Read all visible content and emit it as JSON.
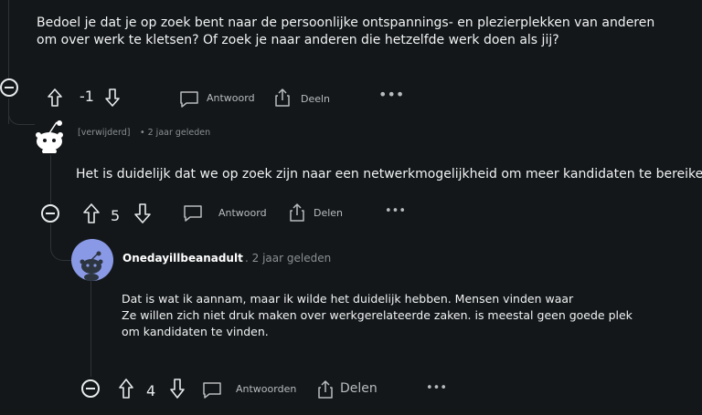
{
  "comment1": {
    "text": "Bedoel je dat je op zoek bent naar de persoonlijke ontspannings- en plezierplekken van anderen om over werk te kletsen? Of zoek je naar anderen die hetzelfde werk doen als jij?",
    "score": "-1",
    "reply_label": "Antwoord",
    "share_label": "Deeln"
  },
  "comment2": {
    "author": "[verwijderd]",
    "time": "• 2 jaar geleden",
    "text": "Het is duidelijk dat we op zoek zijn naar een netwerkmogelijkheid om meer kandidaten te bereiken",
    "score": "5",
    "reply_label": "Antwoord",
    "share_label": "Delen"
  },
  "comment3": {
    "author": "Onedayillbeanadult",
    "time": ". 2 jaar geleden",
    "text_line1": "Dat is wat ik aannam, maar ik wilde het duidelijk hebben. Mensen vinden waar",
    "text_line2": "Ze willen zich niet druk maken over werkgerelateerde zaken. is meestal geen goede plek",
    "text_line3": "om kandidaten te vinden.",
    "score": "4",
    "reply_label": "Antwoorden",
    "share_label": "Delen"
  }
}
